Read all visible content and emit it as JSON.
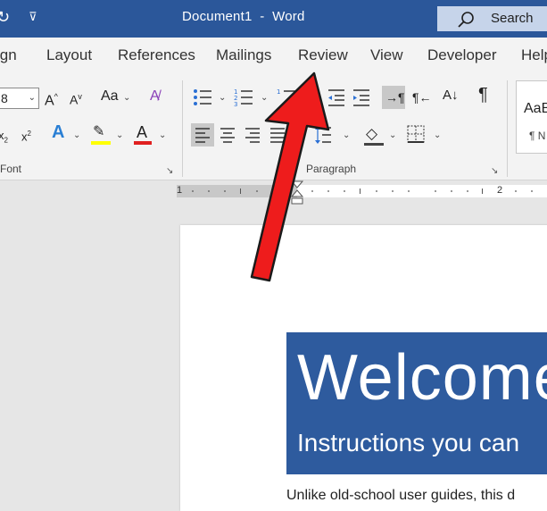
{
  "titlebar": {
    "document_title": "Document1  -  Word",
    "search_label": "Search"
  },
  "tabs": [
    {
      "label": "ign"
    },
    {
      "label": "Layout"
    },
    {
      "label": "References"
    },
    {
      "label": "Mailings"
    },
    {
      "label": "Review"
    },
    {
      "label": "View"
    },
    {
      "label": "Developer"
    },
    {
      "label": "Help"
    }
  ],
  "ribbon": {
    "font_size_value": "8",
    "font_group_label": "Font",
    "paragraph_group_label": "Paragraph",
    "styles_preview_top": "AaB",
    "styles_preview_bottom": "¶ N"
  },
  "ruler": {
    "mark_1": "1",
    "mark_2": "2"
  },
  "document": {
    "banner_title": "Welcome",
    "banner_subtitle": "Instructions you can",
    "body_start": "Unlike old-school user guides, this d"
  },
  "colors": {
    "titlebar": "#2b579a",
    "banner": "#2e5b9e",
    "highlight_yellow": "#ffff00",
    "font_color_red": "#e02020",
    "arrow_red": "#ee1c1c"
  }
}
